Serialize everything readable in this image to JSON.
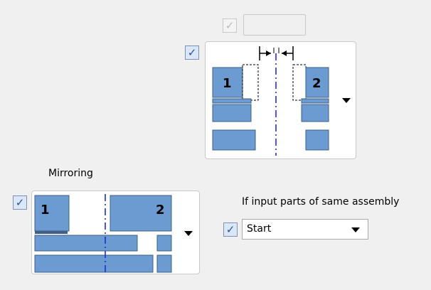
{
  "top_option": {
    "checkbox_checked": true,
    "checkbox_enabled": false,
    "field_value": ""
  },
  "gap_picker": {
    "checkbox_checked": true,
    "part_labels": [
      "1",
      "2"
    ]
  },
  "mirroring": {
    "label": "Mirroring",
    "checkbox_checked": true,
    "part_labels": [
      "1",
      "2"
    ]
  },
  "assembly": {
    "label": "If input parts of same assembly",
    "checkbox_checked": true,
    "select_value": "Start"
  },
  "colors": {
    "part_fill": "#6b9bd1",
    "part_shadow": "#3f5f86",
    "axis": "#1c2fd6"
  }
}
